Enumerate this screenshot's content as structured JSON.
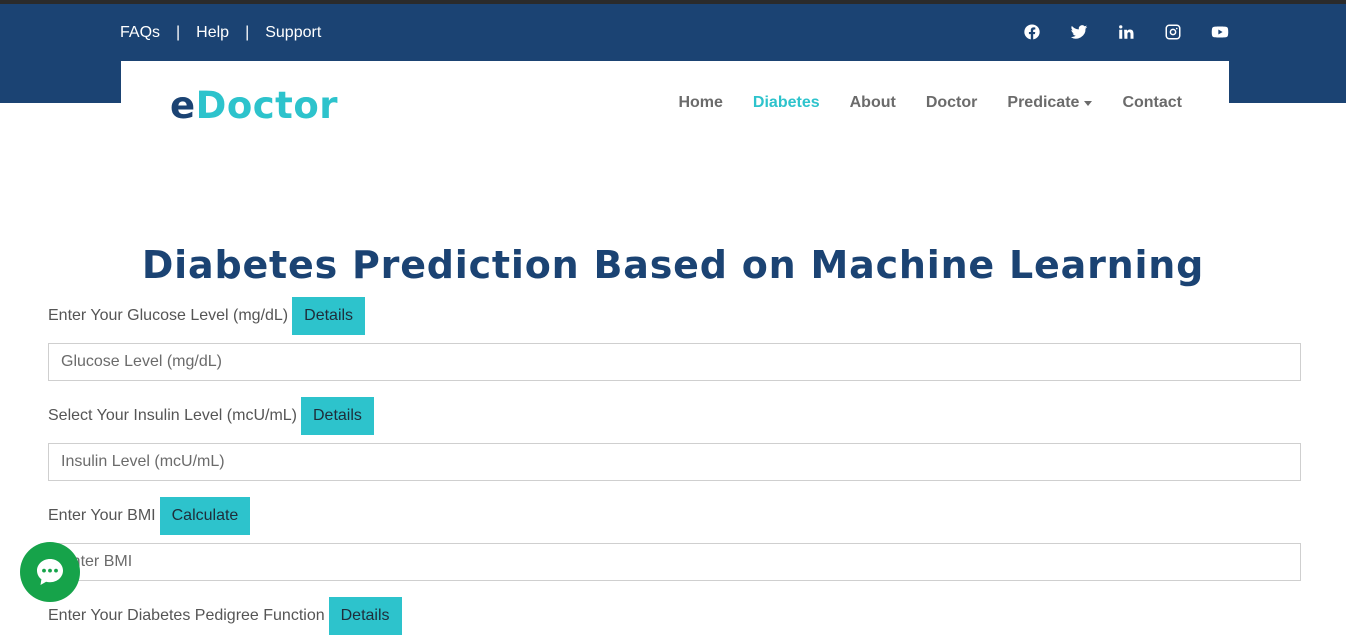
{
  "topbar": {
    "links": [
      "FAQs",
      "Help",
      "Support"
    ],
    "separator": "|",
    "social_icons": [
      "facebook-icon",
      "twitter-icon",
      "linkedin-icon",
      "instagram-icon",
      "youtube-icon"
    ]
  },
  "brand": {
    "prefix": "e",
    "name": "Doctor"
  },
  "nav": {
    "items": [
      "Home",
      "Diabetes",
      "About",
      "Doctor",
      "Predicate",
      "Contact"
    ],
    "active": "Diabetes"
  },
  "page": {
    "title": "Diabetes Prediction Based on Machine Learning"
  },
  "form": {
    "glucose": {
      "label": "Enter Your Glucose Level (mg/dL)",
      "button": "Details",
      "placeholder": "Glucose Level (mg/dL)"
    },
    "insulin": {
      "label": "Select Your Insulin Level (mcU/mL)",
      "button": "Details",
      "placeholder": "Insulin Level (mcU/mL)"
    },
    "bmi": {
      "label": "Enter Your BMI",
      "button": "Calculate",
      "placeholder": "Enter BMI"
    },
    "pedigree": {
      "label": "Enter Your Diabetes Pedigree Function",
      "button": "Details"
    }
  },
  "colors": {
    "primary": "#1b4373",
    "accent": "#2dc3cc",
    "chat": "#16a34a"
  }
}
